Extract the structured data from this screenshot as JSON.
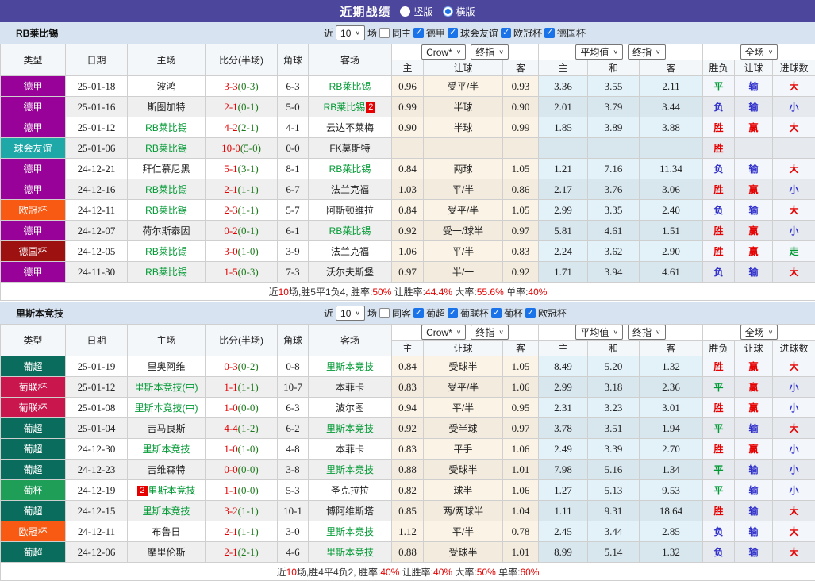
{
  "page": {
    "title": "近期战绩",
    "view_options": [
      {
        "label": "竖版",
        "selected": false
      },
      {
        "label": "横版",
        "selected": true
      }
    ]
  },
  "columns": {
    "fixed": [
      "类型",
      "日期",
      "主场",
      "比分(半场)",
      "角球",
      "客场"
    ],
    "group1": {
      "selects": [
        "Crow*",
        "终指"
      ],
      "cols": [
        "主",
        "让球",
        "客"
      ]
    },
    "group2": {
      "selects": [
        "平均值",
        "终指"
      ],
      "cols": [
        "主",
        "和",
        "客"
      ]
    },
    "group3": {
      "selects": [
        "全场"
      ],
      "cols": [
        "胜负",
        "让球",
        "进球数"
      ]
    }
  },
  "colors": {
    "topbar": "#4c479c",
    "section_bar": "#d7e3f0",
    "checkbox_blue": "#1a73e8",
    "team_green": "#009933",
    "score_red": "#e60000",
    "half_green": "#1e7a1e"
  },
  "league_colors": {
    "德甲": "#980298",
    "球会友谊": "#1fa8a8",
    "欧冠杯": "#f85a14",
    "德国杯": "#9d1111",
    "葡超": "#0a6c5c",
    "葡联杯": "#c9174e",
    "葡杯": "#1e9e57"
  },
  "result_colors": {
    "胜": "#e60000",
    "平": "#009933",
    "负": "#3333cc",
    "赢": "#e60000",
    "输": "#3333cc",
    "大": "#e60000",
    "小": "#3333cc",
    "走": "#009933"
  },
  "sections": [
    {
      "team": "RB莱比锡",
      "filter": {
        "near": "近",
        "count": "10",
        "unit": "场",
        "same": {
          "label": "同主",
          "checked": false
        },
        "leagues": [
          {
            "label": "德甲",
            "checked": true
          },
          {
            "label": "球会友谊",
            "checked": true
          },
          {
            "label": "欧冠杯",
            "checked": true
          },
          {
            "label": "德国杯",
            "checked": true
          }
        ]
      },
      "rows": [
        {
          "type": "德甲",
          "date": "25-01-18",
          "home": {
            "n": "波鸿"
          },
          "score": {
            "m": "3-3",
            "h": "(0-3)"
          },
          "corner": "6-3",
          "away": {
            "n": "RB莱比锡",
            "f": true
          },
          "crow": [
            "0.96",
            "受平/半",
            "0.93"
          ],
          "avg": [
            "3.36",
            "3.55",
            "2.11"
          ],
          "res": [
            "平",
            "输",
            "大"
          ]
        },
        {
          "type": "德甲",
          "date": "25-01-16",
          "home": {
            "n": "斯图加特"
          },
          "score": {
            "m": "2-1",
            "h": "(0-1)"
          },
          "corner": "5-0",
          "away": {
            "n": "RB莱比锡",
            "f": true,
            "badge": "2"
          },
          "crow": [
            "0.99",
            "半球",
            "0.90"
          ],
          "avg": [
            "2.01",
            "3.79",
            "3.44"
          ],
          "res": [
            "负",
            "输",
            "小"
          ]
        },
        {
          "type": "德甲",
          "date": "25-01-12",
          "home": {
            "n": "RB莱比锡",
            "f": true
          },
          "score": {
            "m": "4-2",
            "h": "(2-1)"
          },
          "corner": "4-1",
          "away": {
            "n": "云达不莱梅"
          },
          "crow": [
            "0.90",
            "半球",
            "0.99"
          ],
          "avg": [
            "1.85",
            "3.89",
            "3.88"
          ],
          "res": [
            "胜",
            "赢",
            "大"
          ]
        },
        {
          "type": "球会友谊",
          "date": "25-01-06",
          "home": {
            "n": "RB莱比锡",
            "f": true
          },
          "score": {
            "m": "10-0",
            "h": "(5-0)"
          },
          "corner": "0-0",
          "away": {
            "n": "FK莫斯特"
          },
          "crow": [
            "",
            "",
            ""
          ],
          "avg": [
            "",
            "",
            ""
          ],
          "res": [
            "胜",
            "",
            ""
          ]
        },
        {
          "type": "德甲",
          "date": "24-12-21",
          "home": {
            "n": "拜仁慕尼黑"
          },
          "score": {
            "m": "5-1",
            "h": "(3-1)"
          },
          "corner": "8-1",
          "away": {
            "n": "RB莱比锡",
            "f": true
          },
          "crow": [
            "0.84",
            "两球",
            "1.05"
          ],
          "avg": [
            "1.21",
            "7.16",
            "11.34"
          ],
          "res": [
            "负",
            "输",
            "大"
          ]
        },
        {
          "type": "德甲",
          "date": "24-12-16",
          "home": {
            "n": "RB莱比锡",
            "f": true
          },
          "score": {
            "m": "2-1",
            "h": "(1-1)"
          },
          "corner": "6-7",
          "away": {
            "n": "法兰克福"
          },
          "crow": [
            "1.03",
            "平/半",
            "0.86"
          ],
          "avg": [
            "2.17",
            "3.76",
            "3.06"
          ],
          "res": [
            "胜",
            "赢",
            "小"
          ]
        },
        {
          "type": "欧冠杯",
          "date": "24-12-11",
          "home": {
            "n": "RB莱比锡",
            "f": true
          },
          "score": {
            "m": "2-3",
            "h": "(1-1)"
          },
          "corner": "5-7",
          "away": {
            "n": "阿斯顿维拉"
          },
          "crow": [
            "0.84",
            "受平/半",
            "1.05"
          ],
          "avg": [
            "2.99",
            "3.35",
            "2.40"
          ],
          "res": [
            "负",
            "输",
            "大"
          ]
        },
        {
          "type": "德甲",
          "date": "24-12-07",
          "home": {
            "n": "荷尔斯泰因"
          },
          "score": {
            "m": "0-2",
            "h": "(0-1)"
          },
          "corner": "6-1",
          "away": {
            "n": "RB莱比锡",
            "f": true
          },
          "crow": [
            "0.92",
            "受一/球半",
            "0.97"
          ],
          "avg": [
            "5.81",
            "4.61",
            "1.51"
          ],
          "res": [
            "胜",
            "赢",
            "小"
          ]
        },
        {
          "type": "德国杯",
          "date": "24-12-05",
          "home": {
            "n": "RB莱比锡",
            "f": true
          },
          "score": {
            "m": "3-0",
            "h": "(1-0)"
          },
          "corner": "3-9",
          "away": {
            "n": "法兰克福"
          },
          "crow": [
            "1.06",
            "平/半",
            "0.83"
          ],
          "avg": [
            "2.24",
            "3.62",
            "2.90"
          ],
          "res": [
            "胜",
            "赢",
            "走"
          ]
        },
        {
          "type": "德甲",
          "date": "24-11-30",
          "home": {
            "n": "RB莱比锡",
            "f": true
          },
          "score": {
            "m": "1-5",
            "h": "(0-3)"
          },
          "corner": "7-3",
          "away": {
            "n": "沃尔夫斯堡"
          },
          "crow": [
            "0.97",
            "半/一",
            "0.92"
          ],
          "avg": [
            "1.71",
            "3.94",
            "4.61"
          ],
          "res": [
            "负",
            "输",
            "大"
          ]
        }
      ],
      "summary": [
        {
          "t": "近"
        },
        {
          "t": "10",
          "r": true
        },
        {
          "t": "场,胜5平1负4, 胜率:"
        },
        {
          "t": "50%",
          "r": true
        },
        {
          "t": " 让胜率:"
        },
        {
          "t": "44.4%",
          "r": true
        },
        {
          "t": " 大率:"
        },
        {
          "t": "55.6%",
          "r": true
        },
        {
          "t": " 单率:"
        },
        {
          "t": "40%",
          "r": true
        }
      ]
    },
    {
      "team": "里斯本竞技",
      "filter": {
        "near": "近",
        "count": "10",
        "unit": "场",
        "same": {
          "label": "同客",
          "checked": false
        },
        "leagues": [
          {
            "label": "葡超",
            "checked": true
          },
          {
            "label": "葡联杯",
            "checked": true
          },
          {
            "label": "葡杯",
            "checked": true
          },
          {
            "label": "欧冠杯",
            "checked": true
          }
        ]
      },
      "rows": [
        {
          "type": "葡超",
          "date": "25-01-19",
          "home": {
            "n": "里奥阿维"
          },
          "score": {
            "m": "0-3",
            "h": "(0-2)"
          },
          "corner": "0-8",
          "away": {
            "n": "里斯本竞技",
            "f": true
          },
          "crow": [
            "0.84",
            "受球半",
            "1.05"
          ],
          "avg": [
            "8.49",
            "5.20",
            "1.32"
          ],
          "res": [
            "胜",
            "赢",
            "大"
          ]
        },
        {
          "type": "葡联杯",
          "date": "25-01-12",
          "home": {
            "n": "里斯本竞技(中)",
            "f": true
          },
          "score": {
            "m": "1-1",
            "h": "(1-1)"
          },
          "corner": "10-7",
          "away": {
            "n": "本菲卡"
          },
          "crow": [
            "0.83",
            "受平/半",
            "1.06"
          ],
          "avg": [
            "2.99",
            "3.18",
            "2.36"
          ],
          "res": [
            "平",
            "赢",
            "小"
          ]
        },
        {
          "type": "葡联杯",
          "date": "25-01-08",
          "home": {
            "n": "里斯本竞技(中)",
            "f": true
          },
          "score": {
            "m": "1-0",
            "h": "(0-0)"
          },
          "corner": "6-3",
          "away": {
            "n": "波尔图"
          },
          "crow": [
            "0.94",
            "平/半",
            "0.95"
          ],
          "avg": [
            "2.31",
            "3.23",
            "3.01"
          ],
          "res": [
            "胜",
            "赢",
            "小"
          ]
        },
        {
          "type": "葡超",
          "date": "25-01-04",
          "home": {
            "n": "吉马良斯"
          },
          "score": {
            "m": "4-4",
            "h": "(1-2)"
          },
          "corner": "6-2",
          "away": {
            "n": "里斯本竞技",
            "f": true
          },
          "crow": [
            "0.92",
            "受半球",
            "0.97"
          ],
          "avg": [
            "3.78",
            "3.51",
            "1.94"
          ],
          "res": [
            "平",
            "输",
            "大"
          ]
        },
        {
          "type": "葡超",
          "date": "24-12-30",
          "home": {
            "n": "里斯本竞技",
            "f": true
          },
          "score": {
            "m": "1-0",
            "h": "(1-0)"
          },
          "corner": "4-8",
          "away": {
            "n": "本菲卡"
          },
          "crow": [
            "0.83",
            "平手",
            "1.06"
          ],
          "avg": [
            "2.49",
            "3.39",
            "2.70"
          ],
          "res": [
            "胜",
            "赢",
            "小"
          ]
        },
        {
          "type": "葡超",
          "date": "24-12-23",
          "home": {
            "n": "吉维森特"
          },
          "score": {
            "m": "0-0",
            "h": "(0-0)"
          },
          "corner": "3-8",
          "away": {
            "n": "里斯本竞技",
            "f": true
          },
          "crow": [
            "0.88",
            "受球半",
            "1.01"
          ],
          "avg": [
            "7.98",
            "5.16",
            "1.34"
          ],
          "res": [
            "平",
            "输",
            "小"
          ]
        },
        {
          "type": "葡杯",
          "date": "24-12-19",
          "home": {
            "n": "里斯本竞技",
            "f": true,
            "badge": "2"
          },
          "score": {
            "m": "1-1",
            "h": "(0-0)"
          },
          "corner": "5-3",
          "away": {
            "n": "圣克拉拉"
          },
          "crow": [
            "0.82",
            "球半",
            "1.06"
          ],
          "avg": [
            "1.27",
            "5.13",
            "9.53"
          ],
          "res": [
            "平",
            "输",
            "小"
          ]
        },
        {
          "type": "葡超",
          "date": "24-12-15",
          "home": {
            "n": "里斯本竞技",
            "f": true
          },
          "score": {
            "m": "3-2",
            "h": "(1-1)"
          },
          "corner": "10-1",
          "away": {
            "n": "博阿维斯塔"
          },
          "crow": [
            "0.85",
            "两/两球半",
            "1.04"
          ],
          "avg": [
            "1.11",
            "9.31",
            "18.64"
          ],
          "res": [
            "胜",
            "输",
            "大"
          ]
        },
        {
          "type": "欧冠杯",
          "date": "24-12-11",
          "home": {
            "n": "布鲁日"
          },
          "score": {
            "m": "2-1",
            "h": "(1-1)"
          },
          "corner": "3-0",
          "away": {
            "n": "里斯本竞技",
            "f": true
          },
          "crow": [
            "1.12",
            "平/半",
            "0.78"
          ],
          "avg": [
            "2.45",
            "3.44",
            "2.85"
          ],
          "res": [
            "负",
            "输",
            "大"
          ]
        },
        {
          "type": "葡超",
          "date": "24-12-06",
          "home": {
            "n": "摩里伦斯"
          },
          "score": {
            "m": "2-1",
            "h": "(2-1)"
          },
          "corner": "4-6",
          "away": {
            "n": "里斯本竞技",
            "f": true
          },
          "crow": [
            "0.88",
            "受球半",
            "1.01"
          ],
          "avg": [
            "8.99",
            "5.14",
            "1.32"
          ],
          "res": [
            "负",
            "输",
            "大"
          ]
        }
      ],
      "summary": [
        {
          "t": "近"
        },
        {
          "t": "10",
          "r": true
        },
        {
          "t": "场,胜4平4负2, 胜率:"
        },
        {
          "t": "40%",
          "r": true
        },
        {
          "t": " 让胜率:"
        },
        {
          "t": "40%",
          "r": true
        },
        {
          "t": " 大率:"
        },
        {
          "t": "50%",
          "r": true
        },
        {
          "t": " 单率:"
        },
        {
          "t": "60%",
          "r": true
        }
      ]
    }
  ]
}
